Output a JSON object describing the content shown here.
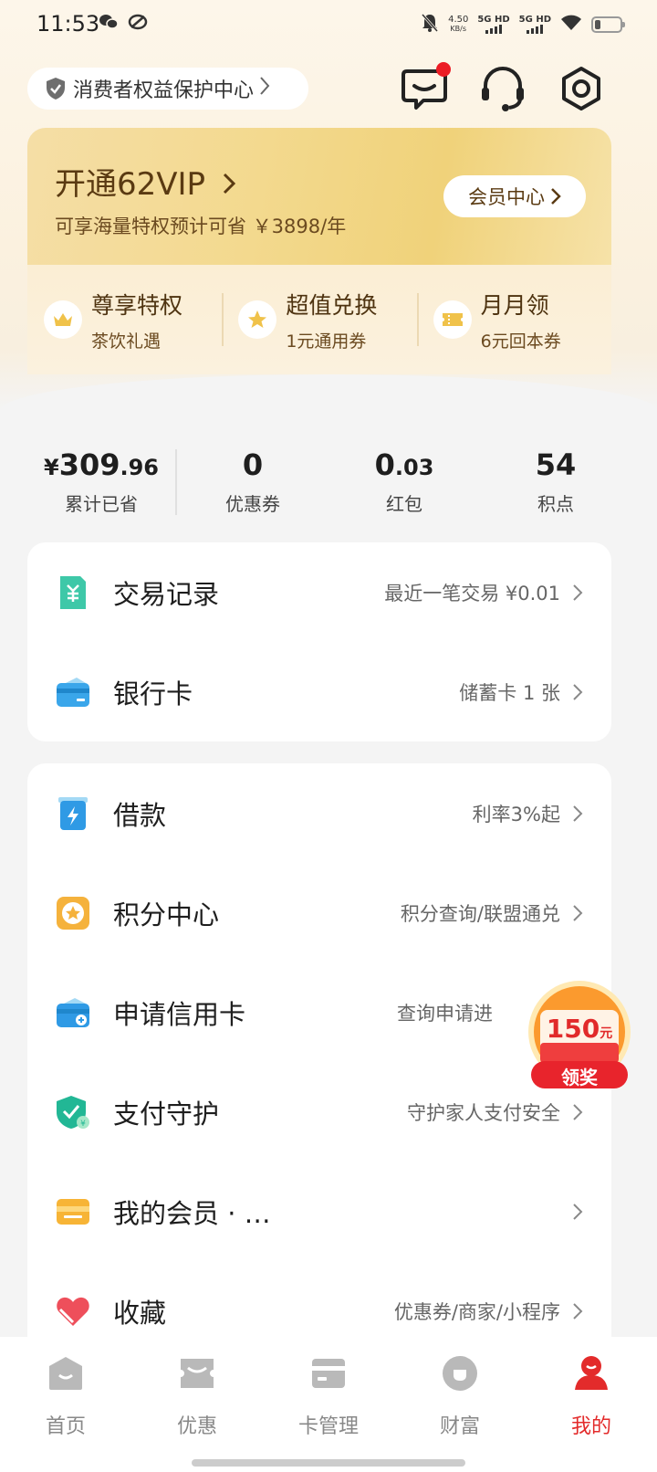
{
  "status_bar": {
    "time": "11:53",
    "net_speed": "4.50",
    "net_speed_unit": "KB/s",
    "sim1": "5G HD",
    "sim2": "5G HD"
  },
  "header": {
    "protection_label": "消费者权益保护中心",
    "icons": [
      "message-icon",
      "customer-service-icon",
      "settings-icon"
    ]
  },
  "vip": {
    "title": "开通62VIP",
    "subtitle": "可享海量特权预计可省 ￥3898/年",
    "member_center": "会员中心",
    "perks": [
      {
        "title": "尊享特权",
        "sub": "茶饮礼遇",
        "icon": "crown-icon"
      },
      {
        "title": "超值兑换",
        "sub": "1元通用券",
        "icon": "star-icon"
      },
      {
        "title": "月月领",
        "sub": "6元回本券",
        "icon": "ticket-icon"
      }
    ]
  },
  "stats": [
    {
      "prefix": "¥",
      "main": "309",
      "decimal": ".96",
      "label": "累计已省"
    },
    {
      "prefix": "",
      "main": "0",
      "decimal": "",
      "label": "优惠券"
    },
    {
      "prefix": "",
      "main": "0",
      "decimal": ".03",
      "label": "红包"
    },
    {
      "prefix": "",
      "main": "54",
      "decimal": "",
      "label": "积点"
    }
  ],
  "card1": [
    {
      "label": "交易记录",
      "value": "最近一笔交易 ¥0.01",
      "icon": "transaction-icon"
    },
    {
      "label": "银行卡",
      "value": "储蓄卡 1 张",
      "icon": "bank-card-icon"
    }
  ],
  "card2": [
    {
      "label": "借款",
      "value": "利率3%起",
      "icon": "loan-icon"
    },
    {
      "label": "积分中心",
      "value": "积分查询/联盟通兑",
      "icon": "points-icon"
    },
    {
      "label": "申请信用卡",
      "value": "查询申请进",
      "icon": "credit-card-icon"
    },
    {
      "label": "支付守护",
      "value": "守护家人支付安全",
      "icon": "shield-icon"
    },
    {
      "label": "我的会员 · …",
      "value": "",
      "icon": "membership-icon"
    },
    {
      "label": "收藏",
      "value": "优惠券/商家/小程序",
      "icon": "heart-icon"
    }
  ],
  "promo": {
    "amount": "150",
    "unit": "元",
    "action": "领奖"
  },
  "bottom_nav": [
    {
      "label": "首页",
      "active": false
    },
    {
      "label": "优惠",
      "active": false
    },
    {
      "label": "卡管理",
      "active": false
    },
    {
      "label": "财富",
      "active": false
    },
    {
      "label": "我的",
      "active": true
    }
  ],
  "colors": {
    "accent": "#e32b2b",
    "vip_gold": "#f3d98e",
    "vip_text": "#5a3a12"
  }
}
